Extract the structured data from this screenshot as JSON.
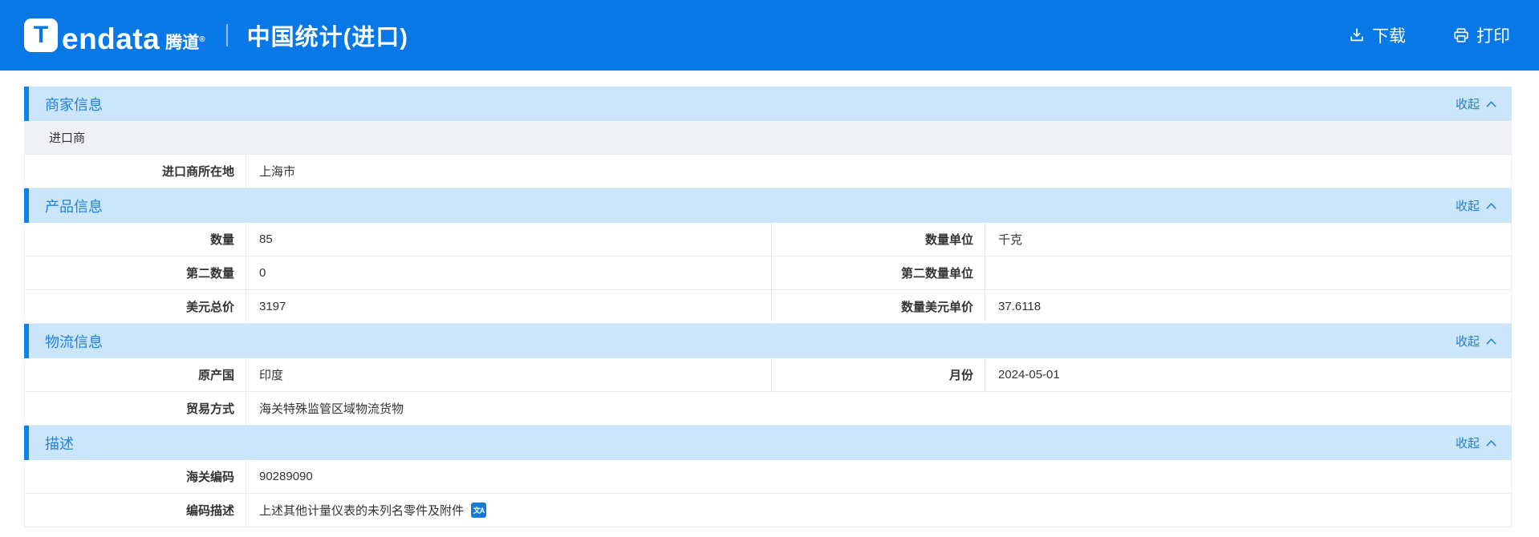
{
  "header": {
    "logo_letter": "T",
    "logo_word": "endata",
    "logo_cn": "腾道",
    "logo_reg": "®",
    "title": "中国统计(进口)",
    "download_label": "下载",
    "print_label": "打印"
  },
  "ui": {
    "collapse_label": "收起",
    "translate_glyph": "文A"
  },
  "colors": {
    "brand_blue": "#0778e6",
    "section_bar_bg": "#cbe5fa",
    "section_accent": "#0b82ee",
    "link_blue": "#1d80dc"
  },
  "sections": {
    "merchant": {
      "title": "商家信息",
      "importer_label": "进口商",
      "rows": {
        "location": {
          "label": "进口商所在地",
          "value": "上海市"
        }
      }
    },
    "product": {
      "title": "产品信息",
      "rows": {
        "qty": {
          "label": "数量",
          "value": "85"
        },
        "qty_unit": {
          "label": "数量单位",
          "value": "千克"
        },
        "qty2": {
          "label": "第二数量",
          "value": "0"
        },
        "qty2_unit": {
          "label": "第二数量单位",
          "value": ""
        },
        "usd_total": {
          "label": "美元总价",
          "value": "3197"
        },
        "usd_unit_price": {
          "label": "数量美元单价",
          "value": "37.6118"
        }
      }
    },
    "logistics": {
      "title": "物流信息",
      "rows": {
        "origin": {
          "label": "原产国",
          "value": "印度"
        },
        "month": {
          "label": "月份",
          "value": "2024-05-01"
        },
        "trade_mode": {
          "label": "贸易方式",
          "value": "海关特殊监管区域物流货物"
        }
      }
    },
    "description": {
      "title": "描述",
      "rows": {
        "hs_code": {
          "label": "海关编码",
          "value": "90289090"
        },
        "code_desc": {
          "label": "编码描述",
          "value": "上述其他计量仪表的未列名零件及附件"
        }
      }
    }
  }
}
